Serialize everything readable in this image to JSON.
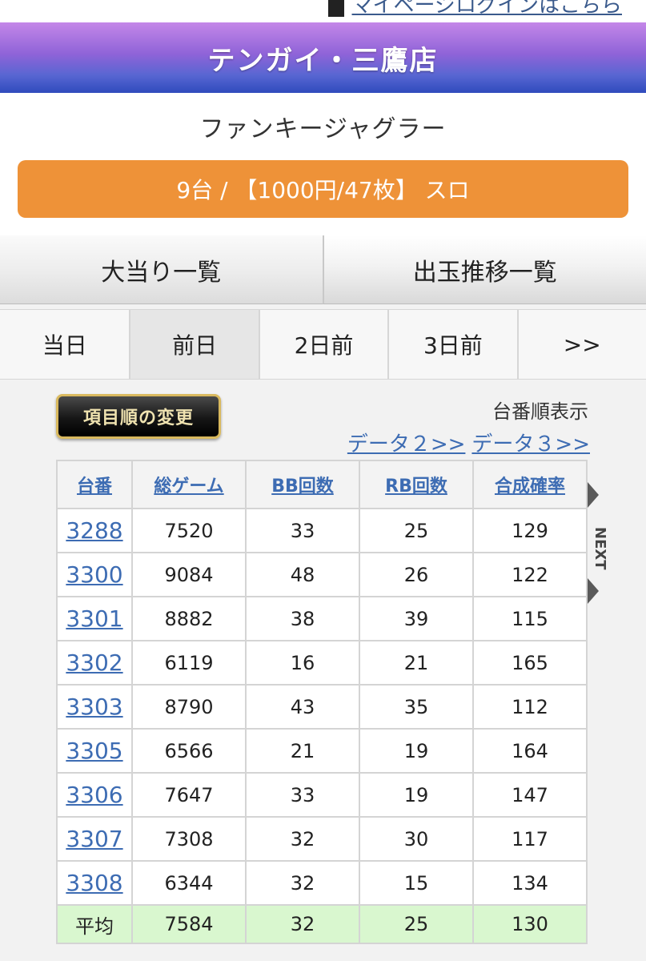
{
  "header": {
    "login_text": "マイページログインはこちら",
    "store_name": "テンガイ・三鷹店"
  },
  "machine": {
    "name": "ファンキージャグラー",
    "rate": "9台 / 【1000円/47枚】 スロ"
  },
  "view_tabs": [
    {
      "label": "大当り一覧",
      "active": true
    },
    {
      "label": "出玉推移一覧",
      "active": false
    }
  ],
  "day_tabs": [
    {
      "label": "当日"
    },
    {
      "label": "前日",
      "selected": true
    },
    {
      "label": "2日前"
    },
    {
      "label": "3日前"
    },
    {
      "label": ">>"
    }
  ],
  "controls": {
    "sort_button": "項目順の変更",
    "order_label": "台番順表示",
    "data2_link": "データ２>>",
    "data3_link": "データ３>>",
    "next_label": "NEXT"
  },
  "table": {
    "headers": [
      "台番",
      "総ゲーム",
      "BB回数",
      "RB回数",
      "合成確率"
    ],
    "rows": [
      [
        "3288",
        "7520",
        "33",
        "25",
        "129"
      ],
      [
        "3300",
        "9084",
        "48",
        "26",
        "122"
      ],
      [
        "3301",
        "8882",
        "38",
        "39",
        "115"
      ],
      [
        "3302",
        "6119",
        "16",
        "21",
        "165"
      ],
      [
        "3303",
        "8790",
        "43",
        "35",
        "112"
      ],
      [
        "3305",
        "6566",
        "21",
        "19",
        "164"
      ],
      [
        "3306",
        "7647",
        "33",
        "19",
        "147"
      ],
      [
        "3307",
        "7308",
        "32",
        "30",
        "117"
      ],
      [
        "3308",
        "6344",
        "32",
        "15",
        "134"
      ]
    ],
    "average": [
      "平均",
      "7584",
      "32",
      "25",
      "130"
    ]
  },
  "colors": {
    "rate_bar": "#ee9238",
    "link": "#3d6cb3",
    "average_row": "#d9f7cf"
  }
}
